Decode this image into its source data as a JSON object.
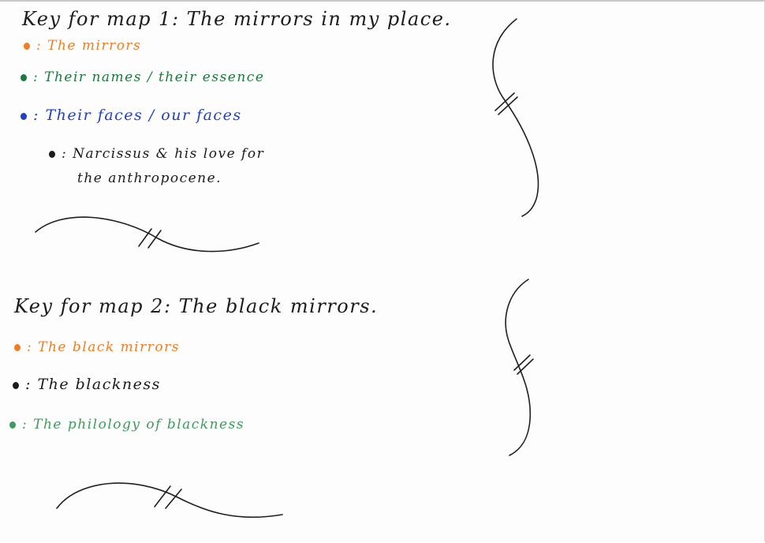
{
  "colors": {
    "orange": "#f07d22",
    "green": "#1a7a3e",
    "blue": "#2140c2",
    "black": "#1b1b1b",
    "light_green": "#3e9a5d"
  },
  "key1": {
    "heading": "Key for map 1: The mirrors in my place.",
    "items": [
      {
        "color": "orange",
        "text": ": The mirrors"
      },
      {
        "color": "green",
        "text": ": Their names / their essence"
      },
      {
        "color": "blue",
        "text": ": Their faces / our faces"
      },
      {
        "color": "black",
        "text": ": Narcissus & his love for",
        "text2": "the anthropocene."
      }
    ]
  },
  "key2": {
    "heading": "Key for map 2: The black mirrors.",
    "items": [
      {
        "color": "orange",
        "text": ": The black mirrors"
      },
      {
        "color": "black",
        "text": ": The blackness"
      },
      {
        "color": "light_green",
        "text": ": The philology of blackness"
      }
    ]
  }
}
